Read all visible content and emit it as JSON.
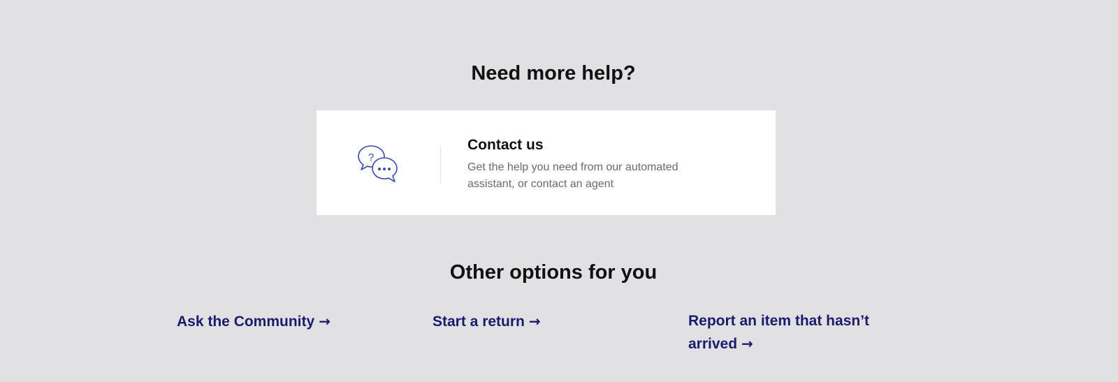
{
  "help_section": {
    "heading": "Need more help?"
  },
  "contact_card": {
    "icon": "chat-bubbles-question-icon",
    "title": "Contact us",
    "description": "Get the help you need from our automated assistant, or contact an agent"
  },
  "options_section": {
    "heading": "Other options for you",
    "links": [
      {
        "label": "Ask the Community",
        "arrow": "→",
        "icon": "arrow-right-icon"
      },
      {
        "label": "Start a return",
        "arrow": "→",
        "icon": "arrow-right-icon"
      },
      {
        "label": "Report an item that hasn’t arrived",
        "arrow": "→",
        "icon": "arrow-right-icon"
      }
    ]
  },
  "colors": {
    "page_background": "#e1e1e3",
    "card_background": "#ffffff",
    "link_color": "#1c1b6b",
    "icon_color": "#3a4bb0",
    "heading_color": "#111111",
    "description_color": "#6a6a6a"
  }
}
